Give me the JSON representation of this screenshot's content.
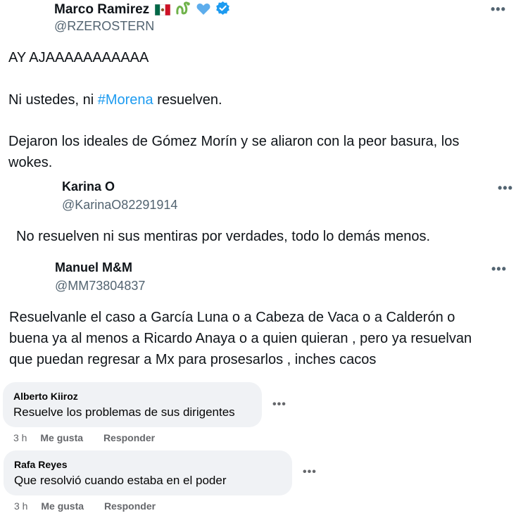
{
  "tweet1": {
    "name": "Marco Ramirez",
    "handle": "@RZEROSTERN",
    "line1": "AY AJAAAAAAAAAAA",
    "line2_pre": "Ni ustedes, ni ",
    "line2_tag": "#Morena",
    "line2_post": " resuelven.",
    "line3": "Dejaron los ideales de Gómez Morín y se aliaron con la peor basura, los",
    "line4": "wokes.",
    "emoji_icons": [
      "mexico-flag-icon",
      "snake-icon",
      "blue-heart-icon",
      "verified-badge-icon"
    ]
  },
  "tweet2": {
    "name": "Karina O",
    "handle": "@KarinaO82291914",
    "text": "No resuelven ni sus mentiras por verdades, todo lo demás menos."
  },
  "tweet3": {
    "name": "Manuel M&M",
    "handle": "@MM73804837",
    "line1": "Resuelvanle el caso a García Luna o a Cabeza de Vaca o a Calderón o",
    "line2": "buena ya al menos a Ricardo Anaya o a quien quieran , pero ya resuelvan",
    "line3": "que puedan regresar a Mx para prosesarlos , inches cacos"
  },
  "more_label": "•••",
  "comments": [
    {
      "name": "Alberto Kiiroz",
      "text": "Resuelve los problemas de sus dirigentes",
      "time": "3 h",
      "like": "Me gusta",
      "reply": "Responder"
    },
    {
      "name": "Rafa Reyes",
      "text": "Que resolvió cuando estaba en el poder",
      "time": "3 h",
      "like": "Me gusta",
      "reply": "Responder"
    }
  ],
  "colors": {
    "hashtag": "#1d9bf0",
    "verified": "#1d9bf0",
    "bubble": "#f0f2f5"
  }
}
